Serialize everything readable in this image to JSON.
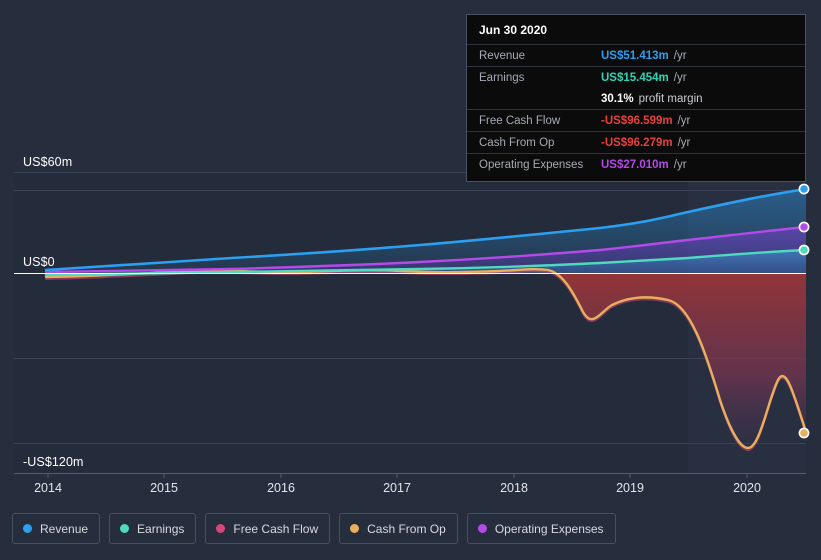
{
  "tooltip": {
    "date": "Jun 30 2020",
    "rows": [
      {
        "key": "Revenue",
        "value": "US$51.413m",
        "unit": "/yr",
        "color": "#2b9ff0"
      },
      {
        "key": "Earnings",
        "value": "US$15.454m",
        "unit": "/yr",
        "color": "#2fd4b6"
      },
      {
        "key": "",
        "value": "30.1%",
        "sub": "profit margin",
        "color": "#ffffff"
      },
      {
        "key": "Free Cash Flow",
        "value": "-US$96.599m",
        "unit": "/yr",
        "color": "#e8413c"
      },
      {
        "key": "Cash From Op",
        "value": "-US$96.279m",
        "unit": "/yr",
        "color": "#e8413c"
      },
      {
        "key": "Operating Expenses",
        "value": "US$27.010m",
        "unit": "/yr",
        "color": "#b44ae8"
      }
    ]
  },
  "legend": [
    {
      "label": "Revenue",
      "color": "#2b9ff0"
    },
    {
      "label": "Earnings",
      "color": "#4fd9c0"
    },
    {
      "label": "Free Cash Flow",
      "color": "#d9467e"
    },
    {
      "label": "Cash From Op",
      "color": "#e8b05c"
    },
    {
      "label": "Operating Expenses",
      "color": "#b44ae8"
    }
  ],
  "chart_data": {
    "type": "line",
    "title": "",
    "xlabel": "",
    "ylabel": "",
    "ylim": [
      -120,
      60
    ],
    "y_ticks": [
      60,
      0,
      -120
    ],
    "y_tick_labels": [
      "US$60m",
      "US$0",
      "-US$120m"
    ],
    "x_tick_labels": [
      "2014",
      "2015",
      "2016",
      "2017",
      "2018",
      "2019",
      "2020"
    ],
    "x": [
      2014,
      2015,
      2016,
      2017,
      2018,
      2019,
      2020
    ],
    "grid": true,
    "legend_position": "bottom",
    "currency": "US$",
    "units": "m",
    "series": [
      {
        "name": "Revenue",
        "color": "#2b9ff0",
        "values": [
          2.0,
          5.0,
          8.5,
          11.5,
          15.0,
          23.0,
          51.4
        ]
      },
      {
        "name": "Earnings",
        "color": "#4fd9c0",
        "values": [
          -2.0,
          0.5,
          1.5,
          2.5,
          3.5,
          7.0,
          15.5
        ]
      },
      {
        "name": "Free Cash Flow",
        "color": "#d9467e",
        "values": [
          -3.0,
          -1.5,
          2.0,
          1.5,
          2.0,
          -36.0,
          -96.6
        ]
      },
      {
        "name": "Cash From Op",
        "color": "#e8b05c",
        "values": [
          -4.0,
          -1.0,
          3.0,
          1.0,
          2.0,
          -36.0,
          -96.3
        ]
      },
      {
        "name": "Operating Expenses",
        "color": "#b44ae8",
        "values": [
          1.0,
          2.0,
          4.0,
          6.0,
          8.5,
          13.0,
          27.0
        ]
      }
    ]
  }
}
